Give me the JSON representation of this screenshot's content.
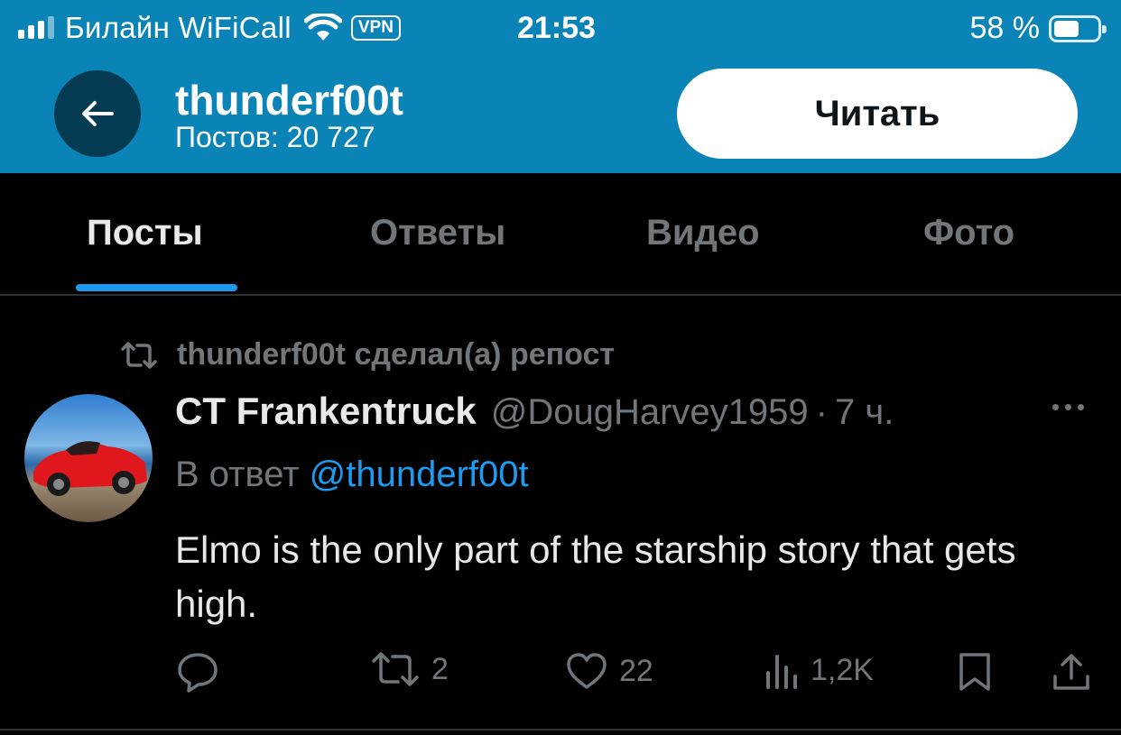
{
  "status_bar": {
    "carrier": "Билайн WiFiCall",
    "vpn_label": "VPN",
    "time": "21:53",
    "battery": "58 %",
    "battery_level": 0.58
  },
  "header": {
    "name": "thunderf00t",
    "posts_count": "Постов: 20 727",
    "follow_label": "Читать",
    "back_icon": "arrow-left-icon"
  },
  "tabs": [
    {
      "label": "Посты",
      "active": true
    },
    {
      "label": "Ответы",
      "active": false
    },
    {
      "label": "Видео",
      "active": false
    },
    {
      "label": "Фото",
      "active": false
    }
  ],
  "post": {
    "repost_text": "thunderf00t сделал(а) репост",
    "author_name": "CT Frankentruck",
    "author_handle": "@DougHarvey1959",
    "separator": "·",
    "time": "7 ч.",
    "reply_prefix": "В ответ",
    "reply_mention": "@thunderf00t",
    "text": "Elmo is the only part of the starship story that gets high.",
    "actions": {
      "reply_icon": "reply-bubble-icon",
      "retweet_count": "2",
      "like_count": "22",
      "views_count": "1,2K",
      "bookmark_icon": "bookmark-icon",
      "share_icon": "share-icon"
    }
  },
  "colors": {
    "header_bg": "#0a84b7",
    "accent": "#1d9bf0",
    "muted": "#71767b",
    "text": "#e7e9ea",
    "bg": "#000000"
  }
}
